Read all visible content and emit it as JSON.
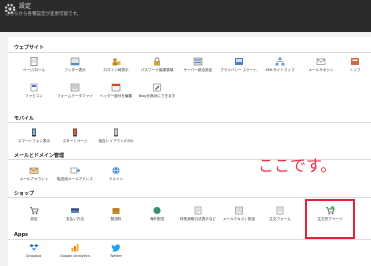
{
  "header": {
    "title": "設定",
    "subtitle": "こちらから各種設定が変更可能です。"
  },
  "sections": {
    "website": "ウェブサイト",
    "mobile": "モバイル",
    "mail": "メールとドメイン管理",
    "shop": "ショップ",
    "apps": "Apps"
  },
  "website_items": [
    {
      "label": "ページ/ロール",
      "icon": "page-icon"
    },
    {
      "label": "フッター表示",
      "icon": "footer-icon"
    },
    {
      "label": "ログイン時表示",
      "icon": "login-icon"
    },
    {
      "label": "パスワード保護領域",
      "icon": "lock-icon"
    },
    {
      "label": "サーバー統合設定",
      "icon": "server-icon"
    },
    {
      "label": "プライバシー ステートメント",
      "icon": "privacy-icon"
    },
    {
      "label": "XMLサイトマップ",
      "icon": "sitemap-icon"
    },
    {
      "label": "メールサポジン",
      "icon": "mail-icon"
    },
    {
      "label": "トップ",
      "icon": "top-icon"
    },
    {
      "label": "ファビコン",
      "icon": "favicon-icon"
    },
    {
      "label": "フォームデータファイ",
      "icon": "form-data-icon"
    },
    {
      "label": "ヘッダー部分を編集",
      "icon": "header-edit-icon"
    },
    {
      "label": "Blogを無効にできます",
      "icon": "blog-icon"
    }
  ],
  "mobile_items": [
    {
      "label": "スマートフォン表示",
      "icon": "smartphone-icon"
    },
    {
      "label": "スタートページ",
      "icon": "start-page-icon"
    },
    {
      "label": "独自レイアウト(CSS)",
      "icon": "css-icon"
    }
  ],
  "mail_items": [
    {
      "label": "メールアカウント",
      "icon": "mail-account-icon"
    },
    {
      "label": "転送用メールアドレス",
      "icon": "forward-icon"
    },
    {
      "label": "ドメイン",
      "icon": "domain-icon"
    }
  ],
  "shop_items": [
    {
      "label": "設定",
      "icon": "shop-settings-icon"
    },
    {
      "label": "支払い方法",
      "icon": "payment-icon"
    },
    {
      "label": "配送料",
      "icon": "shipping-icon"
    },
    {
      "label": "海外配送",
      "icon": "overseas-icon"
    },
    {
      "label": "特別商取引法表示など",
      "icon": "law-icon"
    },
    {
      "label": "メールテキスト設定",
      "icon": "mail-text-icon"
    },
    {
      "label": "注文フォーム",
      "icon": "order-form-icon"
    },
    {
      "label": "注文完了ページ",
      "icon": "order-complete-icon"
    }
  ],
  "apps_items": [
    {
      "label": "Dropbox",
      "icon": "dropbox-icon"
    },
    {
      "label": "Google Analytics",
      "icon": "analytics-icon"
    },
    {
      "label": "Twitter",
      "icon": "twitter-icon"
    }
  ],
  "annotation": {
    "note": "ここです。"
  }
}
